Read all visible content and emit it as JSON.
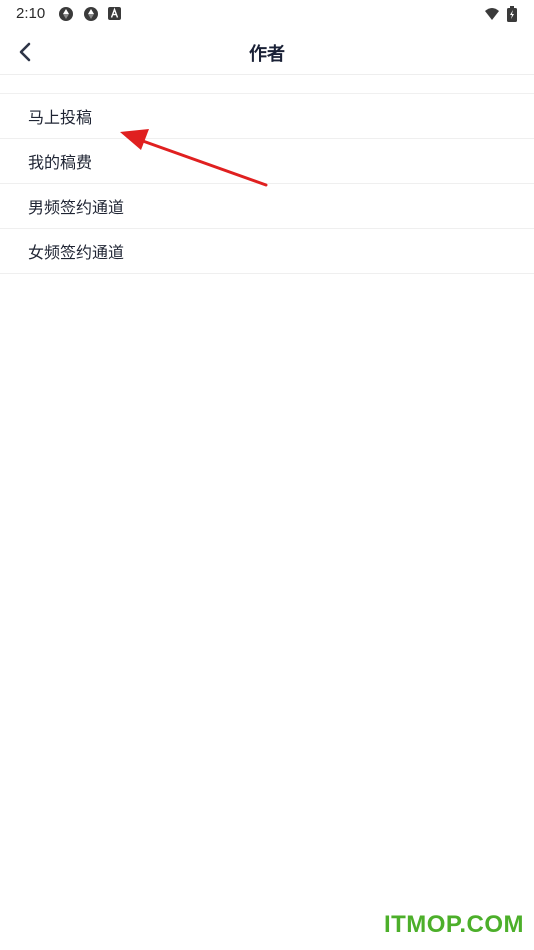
{
  "status_bar": {
    "time": "2:10",
    "icons": [
      "aperture-icon",
      "aperture-icon",
      "a-box-icon",
      "wifi-icon",
      "battery-icon"
    ]
  },
  "header": {
    "title": "作者",
    "back_icon": "chevron-left-icon"
  },
  "menu": {
    "items": [
      {
        "label": "马上投稿"
      },
      {
        "label": "我的稿费"
      },
      {
        "label": "男频签约通道"
      },
      {
        "label": "女频签约通道"
      }
    ]
  },
  "annotation": {
    "arrow_color": "#e02020"
  },
  "watermark": {
    "text": "ITMOP.COM",
    "color": "#4caf2a"
  }
}
